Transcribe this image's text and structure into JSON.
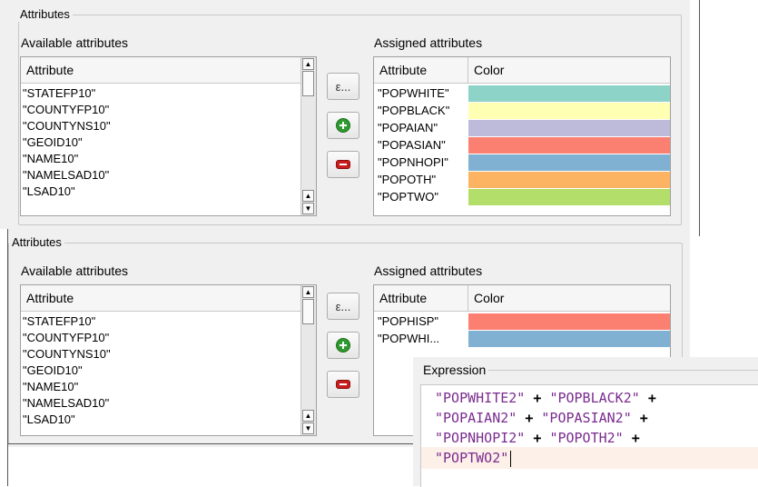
{
  "top": {
    "group_title": "Attributes",
    "available_label": "Available attributes",
    "assigned_label": "Assigned attributes",
    "available_header": "Attribute",
    "available_items": [
      "\"STATEFP10\"",
      "\"COUNTYFP10\"",
      "\"COUNTYNS10\"",
      "\"GEOID10\"",
      "\"NAME10\"",
      "\"NAMELSAD10\"",
      "\"LSAD10\""
    ],
    "assigned_header_attr": "Attribute",
    "assigned_header_color": "Color",
    "assigned_items": [
      {
        "name": "\"POPWHITE\"",
        "color": "#8dd3c7"
      },
      {
        "name": "\"POPBLACK\"",
        "color": "#ffffb3"
      },
      {
        "name": "\"POPAIAN\"",
        "color": "#bebada"
      },
      {
        "name": "\"POPASIAN\"",
        "color": "#fb8072"
      },
      {
        "name": "\"POPNHOPI\"",
        "color": "#80b1d3"
      },
      {
        "name": "\"POPOTH\"",
        "color": "#fdb462"
      },
      {
        "name": "\"POPTWO\"",
        "color": "#b3de69"
      }
    ],
    "expr_button": "ε..."
  },
  "bottom": {
    "group_title": "Attributes",
    "available_label": "Available attributes",
    "assigned_label": "Assigned attributes",
    "available_header": "Attribute",
    "available_items": [
      "\"STATEFP10\"",
      "\"COUNTYFP10\"",
      "\"COUNTYNS10\"",
      "\"GEOID10\"",
      "\"NAME10\"",
      "\"NAMELSAD10\"",
      "\"LSAD10\""
    ],
    "assigned_header_attr": "Attribute",
    "assigned_header_color": "Color",
    "assigned_items": [
      {
        "name": "\"POPHISP\"",
        "color": "#fb8072"
      },
      {
        "name": " \"POPWHI...",
        "color": "#80b1d3"
      }
    ],
    "expr_button": "ε..."
  },
  "expression": {
    "title": "Expression",
    "lines": [
      {
        "a": "\"POPWHITE2\"",
        "op": "+",
        "b": "\"POPBLACK2\"",
        "op2": "+"
      },
      {
        "a": "\"POPAIAN2\"",
        "op": "+",
        "b": "\"POPASIAN2\"",
        "op2": "+"
      },
      {
        "a": "\"POPNHOPI2\"",
        "op": "+",
        "b": "\"POPOTH2\"",
        "op2": "+"
      },
      {
        "a": "\"POPTWO2\"",
        "op": "",
        "b": "",
        "op2": ""
      }
    ]
  },
  "icons": {
    "add": "plus-circle-icon",
    "remove": "minus-icon",
    "expression": "epsilon-icon",
    "scroll_up": "arrow-up-icon",
    "scroll_down": "arrow-down-icon"
  }
}
